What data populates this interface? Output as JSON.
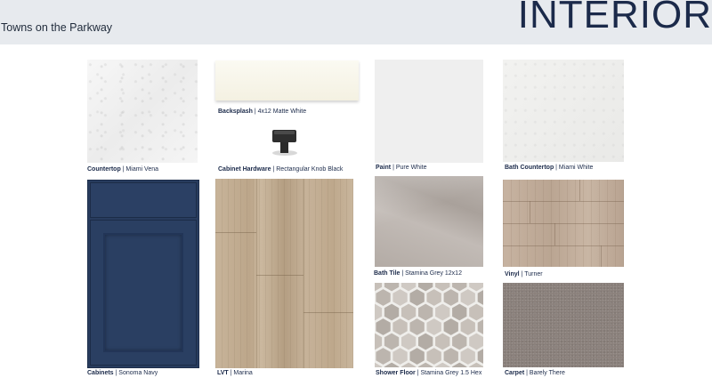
{
  "header": {
    "subtitle": "Towns on the Parkway",
    "title": "INTERIOR"
  },
  "swatches": {
    "countertop": {
      "name": "Countertop",
      "value": "| Miami Vena"
    },
    "backsplash": {
      "name": "Backsplash",
      "value": "| 4x12 Matte White"
    },
    "hardware": {
      "name": "Cabinet Hardware",
      "value": "| Rectangular Knob Black"
    },
    "paint": {
      "name": "Paint",
      "value": "| Pure White"
    },
    "bath_countertop": {
      "name": "Bath Countertop",
      "value": "| Miami White"
    },
    "cabinets": {
      "name": "Cabinets",
      "value": "| Sonoma Navy"
    },
    "lvt": {
      "name": "LVT",
      "value": "| Marina"
    },
    "bath_tile": {
      "name": "Bath Tile",
      "value": "| Stamina Grey 12x12"
    },
    "vinyl": {
      "name": "Vinyl",
      "value": "| Turner"
    },
    "shower_floor": {
      "name": "Shower Floor",
      "value": "| Stamina Grey 1.5 Hex"
    },
    "carpet": {
      "name": "Carpet",
      "value": "| Barely There"
    }
  },
  "colors": {
    "header_bg": "#e7eaee",
    "title": "#1b2a4a",
    "cabinet_navy": "#283c5e"
  }
}
